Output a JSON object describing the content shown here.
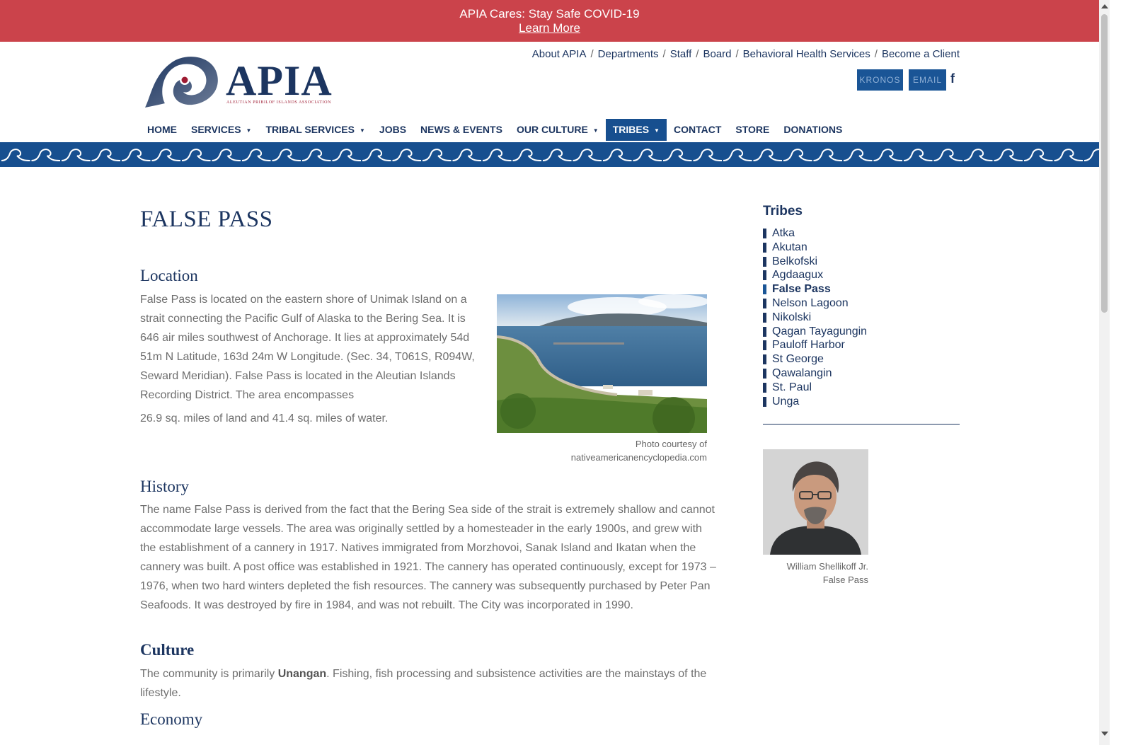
{
  "banner": {
    "title": "APIA Cares: Stay Safe COVID-19",
    "link": "Learn More"
  },
  "logo": {
    "wordmark": "APIA",
    "subtitle": "ALEUTIAN PRIBILOF ISLANDS ASSOCIATION"
  },
  "top_links": [
    "About APIA",
    "Departments",
    "Staff",
    "Board",
    "Behavioral Health Services",
    "Become a Client"
  ],
  "buttons": {
    "kronos": "KRONOS",
    "email": "EMAIL",
    "facebook": "f"
  },
  "nav": [
    {
      "label": "HOME"
    },
    {
      "label": "SERVICES",
      "caret": "▼"
    },
    {
      "label": "TRIBAL SERVICES",
      "caret": "▼"
    },
    {
      "label": "JOBS"
    },
    {
      "label": "NEWS & EVENTS"
    },
    {
      "label": "OUR CULTURE",
      "caret": "▼"
    },
    {
      "label": "TRIBES",
      "caret": "▼"
    },
    {
      "label": "CONTACT"
    },
    {
      "label": "STORE"
    },
    {
      "label": "DONATIONS"
    }
  ],
  "page": {
    "title": "FALSE PASS",
    "location": {
      "heading": "Location",
      "text": "False Pass is located on the eastern shore of Unimak Island on a strait connecting the Pacific Gulf of Alaska to the Bering Sea. It is 646 air miles southwest of Anchorage. It lies at approximately 54d 51m N Latitude, 163d 24m W Longitude. (Sec. 34, T061S, R094W, Seward Meridian). False Pass is located in the Aleutian Islands Recording District. The area encompasses",
      "text2": "26.9 sq. miles of land and 41.4 sq. miles of water.",
      "photo_caption_1": "Photo courtesy of",
      "photo_caption_2": "nativeamericanencyclopedia.com"
    },
    "history": {
      "heading": "History",
      "text": "The name False Pass is derived from the fact that the Bering Sea side of the strait is extremely shallow and cannot accommodate large vessels. The area was originally settled by a homesteader in the early 1900s, and grew with the establishment of a cannery in 1917. Natives immigrated from Morzhovoi, Sanak Island and Ikatan when the cannery was built. A post office was established in 1921. The cannery has operated continuously, except for 1973 – 1976, when two hard winters depleted the fish resources. The cannery was subsequently purchased by Peter Pan Seafoods. It was destroyed by fire in 1984, and was not rebuilt. The City was incorporated in 1990."
    },
    "culture": {
      "heading": "Culture",
      "text_before": "The community is primarily ",
      "text_bold": "Unangan",
      "text_after": ". Fishing, fish processing and subsistence activities are the mainstays of the lifestyle."
    },
    "economy": {
      "heading": "Economy"
    }
  },
  "sidebar": {
    "title": "Tribes",
    "tribes": [
      "Atka",
      "Akutan",
      "Belkofski",
      "Agdaagux",
      "False Pass",
      "Nelson Lagoon",
      "Nikolski",
      "Qagan Tayagungin",
      "Pauloff Harbor",
      "St George",
      "Qawalangin",
      "St. Paul",
      "Unga"
    ],
    "active_index": 4,
    "portrait_caption_1": "William Shellikoff Jr.",
    "portrait_caption_2": "False Pass"
  },
  "colors": {
    "banner": "#cb434b",
    "navy": "#1c3560",
    "accent_blue": "#174f8f",
    "body_text": "#6e6e6e"
  }
}
